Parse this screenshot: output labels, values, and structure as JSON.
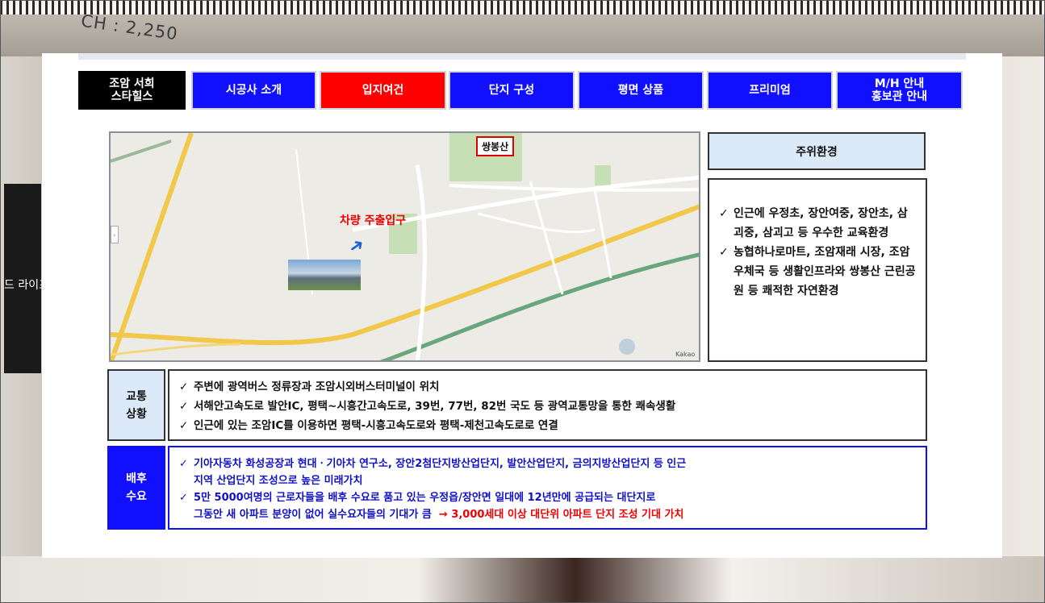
{
  "background": {
    "ceiling_sign": "CH : 2,250",
    "tv_text": "드 라이프"
  },
  "nav": {
    "tabs": [
      {
        "label": "조암 서희\n스타힐스",
        "style": "black"
      },
      {
        "label": "시공사 소개",
        "style": "blue"
      },
      {
        "label": "입지여건",
        "style": "red"
      },
      {
        "label": "단지 구성",
        "style": "blue"
      },
      {
        "label": "평면 상품",
        "style": "blue"
      },
      {
        "label": "프리미엄",
        "style": "blue"
      },
      {
        "label": "M/H 안내\n홍보관 안내",
        "style": "blue"
      }
    ]
  },
  "map": {
    "peak_label": "쌍봉산",
    "entry_label": "차량 주출입구",
    "scale_label": "Kakao"
  },
  "environment": {
    "title": "주위환경",
    "items": [
      "인근에 우정초, 장안여중, 장안초, 삼괴중, 삼괴고 등 우수한 교육환경",
      "농협하나로마트, 조암재래 시장, 조암우체국 등 생활인프라와 쌍봉산 근린공원 등 쾌적한 자연환경"
    ]
  },
  "traffic": {
    "label": "교통\n상황",
    "items": [
      "주변에 광역버스 정류장과 조암시외버스터미널이 위치",
      "서해안고속도로 발안IC, 평택~시흥간고속도로, 39번, 77번, 82번 국도 등 광역교통망을 통한 쾌속생활",
      "인근에 있는 조암IC를 이용하면 평택-시흥고속도로와 평택-제천고속도로로 연결"
    ]
  },
  "demand": {
    "label": "배후\n수요",
    "line1": "기아자동차 화성공장과 현대ㆍ기아차 연구소, 장안2첨단지방산업단지, 발안산업단지, 금의지방산업단지 등 인근",
    "line1b": "지역 산업단지 조성으로 높은 미래가치",
    "line2": "5만 5000여명의 근로자들을 배후 수요로 품고 있는 우정읍/장안면 일대에 12년만에 공급되는 대단지로",
    "line2b": "그동안 새 아파트 분양이 없어 실수요자들의 기대가 큼",
    "line2_highlight": "→ 3,000세대 이상 대단위 아파트 단지 조성 기대 가치"
  },
  "check_mark": "✓"
}
